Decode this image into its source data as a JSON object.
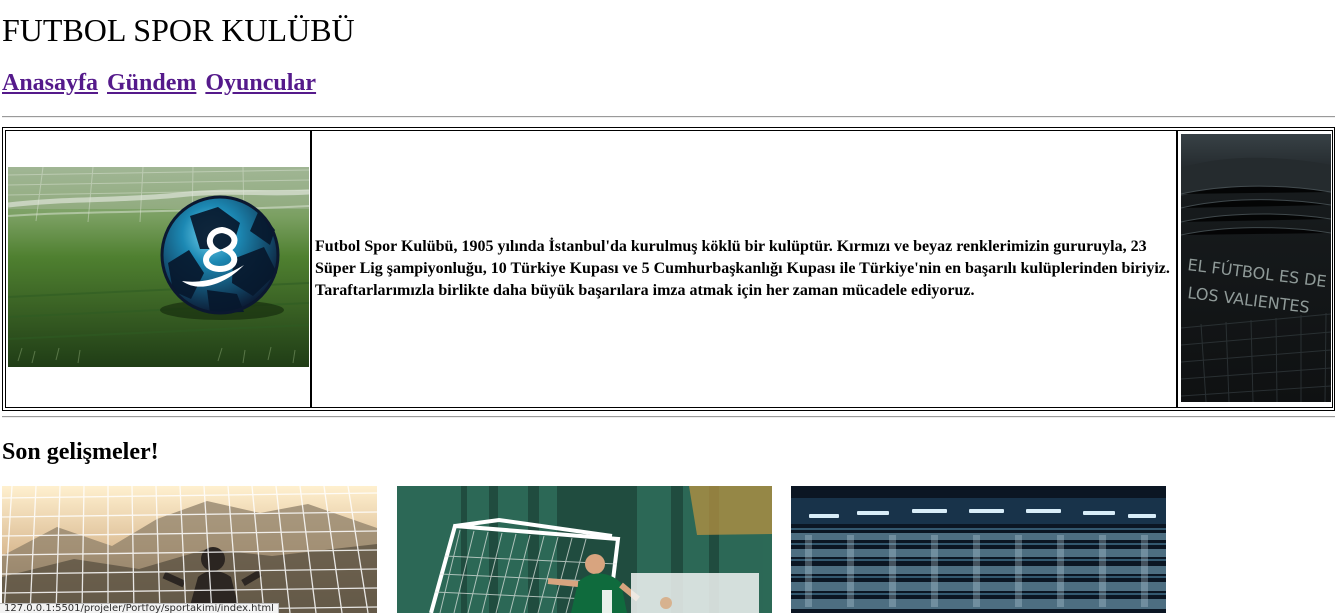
{
  "site": {
    "title": "FUTBOL SPOR KULÜBÜ",
    "nav": [
      {
        "label": "Anasayfa"
      },
      {
        "label": "Gündem"
      },
      {
        "label": "Oyuncular"
      }
    ]
  },
  "intro": {
    "description": "Futbol Spor Kulübü, 1905 yılında İstanbul'da kurulmuş köklü bir kulüptür. Kırmızı ve beyaz renklerimizin gururuyla, 23 Süper Lig şampiyonluğu, 10 Türkiye Kupası ve 5 Cumhurbaşkanlığı Kupası ile Türkiye'nin en başarılı kulüplerinden biriyiz. Taraftarlarımızla birlikte daha büyük başarılara imza atmak için her zaman mücadele ediyoruz.",
    "left_image": {
      "icon": "soccer-ball-photo"
    },
    "right_image": {
      "icon": "stadium-wall-photo",
      "text_lines": [
        "EL FÚTBOL ES DE",
        "LOS VALIENTES"
      ]
    }
  },
  "latest": {
    "heading": "Son gelişmeler!",
    "images": [
      {
        "icon": "goalkeeper-net-photo"
      },
      {
        "icon": "player-goal-photo"
      },
      {
        "icon": "stadium-crowd-photo"
      }
    ]
  },
  "status_bar": {
    "url": "127.0.0.1:5501/projeler/Portfoy/sportakimi/index.html"
  },
  "colors": {
    "link": "#551a8b",
    "border": "#000000",
    "divider": "#9a9a9a",
    "tooltip_background": "#f3f3f3"
  }
}
